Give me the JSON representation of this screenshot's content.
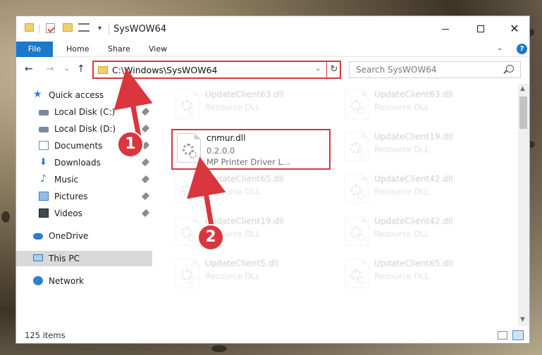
{
  "window": {
    "title": "SysWOW64"
  },
  "ribbon": {
    "tabs": [
      "File",
      "Home",
      "Share",
      "View"
    ],
    "help_label": "?"
  },
  "address": {
    "path": "C:\\Windows\\SysWOW64",
    "search_placeholder": "Search SysWOW64"
  },
  "sidebar": {
    "items": [
      {
        "label": "Quick access",
        "icon": "star-icon",
        "pinned": false
      },
      {
        "label": "Local Disk (C:)",
        "icon": "drive-icon",
        "pinned": true
      },
      {
        "label": "Local Disk (D:)",
        "icon": "drive-icon",
        "pinned": true
      },
      {
        "label": "Documents",
        "icon": "documents-icon",
        "pinned": true
      },
      {
        "label": "Downloads",
        "icon": "download-icon",
        "pinned": true
      },
      {
        "label": "Music",
        "icon": "music-icon",
        "pinned": true
      },
      {
        "label": "Pictures",
        "icon": "pictures-icon",
        "pinned": true
      },
      {
        "label": "Videos",
        "icon": "videos-icon",
        "pinned": true
      },
      {
        "label": "OneDrive",
        "icon": "cloud-icon",
        "pinned": false
      },
      {
        "label": "This PC",
        "icon": "computer-icon",
        "pinned": false,
        "selected": true
      },
      {
        "label": "Network",
        "icon": "network-icon",
        "pinned": false
      }
    ]
  },
  "files": {
    "tiles": [
      {
        "name": "UpdateClient63.dll",
        "line2": "Resource DLL",
        "line3": "",
        "faded": true
      },
      {
        "name": "UpdateClient63.dll",
        "line2": "Resource DLL",
        "line3": "",
        "faded": true
      },
      {
        "name": "cnmur.dll",
        "line2": "0.2.0.0",
        "line3": "MP Printer Driver L...",
        "faded": false,
        "highlighted": true
      },
      {
        "name": "UpdateClient19.dll",
        "line2": "Resource DLL",
        "line3": "",
        "faded": true
      },
      {
        "name": "UpdateClient65.dll",
        "line2": "Resource DLL",
        "line3": "",
        "faded": true
      },
      {
        "name": "UpdateClient42.dll",
        "line2": "Resource DLL",
        "line3": "",
        "faded": true
      },
      {
        "name": "UpdateClient19.dll",
        "line2": "Resource DLL",
        "line3": "",
        "faded": true
      },
      {
        "name": "UpdateClient42.dll",
        "line2": "Resource DLL",
        "line3": "",
        "faded": true
      },
      {
        "name": "UpdateClient5.dll",
        "line2": "Resource DLL",
        "line3": "",
        "faded": true
      },
      {
        "name": "UpdateClient65.dll",
        "line2": "Resource DLL",
        "line3": "",
        "faded": true
      }
    ]
  },
  "status": {
    "count": "125 items"
  },
  "annotations": {
    "step1": "1",
    "step2": "2",
    "highlight_color": "#d9363e"
  },
  "colors": {
    "accent": "#1979ca",
    "selected_nav": "#d9d9d9"
  }
}
